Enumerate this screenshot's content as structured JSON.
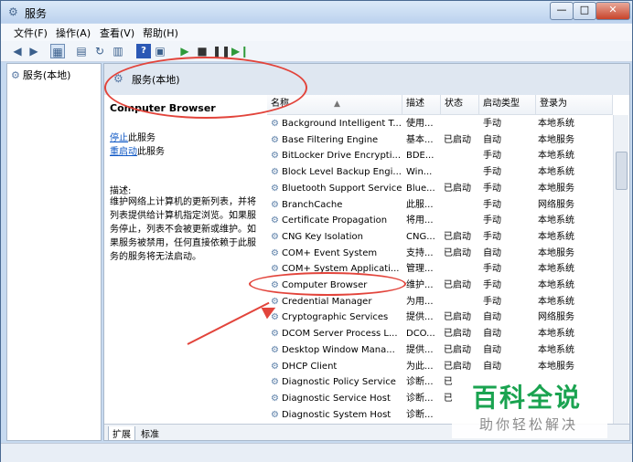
{
  "window": {
    "title": "服务",
    "min_glyph": "—",
    "max_glyph": "□",
    "close_glyph": "✕"
  },
  "menu": [
    "文件(F)",
    "操作(A)",
    "查看(V)",
    "帮助(H)"
  ],
  "toolbar": {
    "help_glyph": "?"
  },
  "tree": {
    "root_label": "服务(本地)"
  },
  "header": {
    "title": "服务(本地)"
  },
  "detail": {
    "service_name": "Computer Browser",
    "stop_link": "停止",
    "stop_suffix": "此服务",
    "restart_link": "重启动",
    "restart_suffix": "此服务",
    "desc_label": "描述:",
    "desc_text": "维护网络上计算机的更新列表，并将列表提供给计算机指定浏览。如果服务停止，列表不会被更新或维护。如果服务被禁用，任何直接依赖于此服务的服务将无法启动。"
  },
  "columns": {
    "name": "名称",
    "desc": "描述",
    "status": "状态",
    "startup": "启动类型",
    "logon": "登录为"
  },
  "services": [
    {
      "name": "Background Intelligent T...",
      "desc": "使用...",
      "status": "",
      "startup": "手动",
      "logon": "本地系统"
    },
    {
      "name": "Base Filtering Engine",
      "desc": "基本...",
      "status": "已启动",
      "startup": "自动",
      "logon": "本地服务"
    },
    {
      "name": "BitLocker Drive Encrypti...",
      "desc": "BDE...",
      "status": "",
      "startup": "手动",
      "logon": "本地系统"
    },
    {
      "name": "Block Level Backup Engi...",
      "desc": "Win...",
      "status": "",
      "startup": "手动",
      "logon": "本地系统"
    },
    {
      "name": "Bluetooth Support Service",
      "desc": "Blue...",
      "status": "已启动",
      "startup": "手动",
      "logon": "本地服务"
    },
    {
      "name": "BranchCache",
      "desc": "此服...",
      "status": "",
      "startup": "手动",
      "logon": "网络服务"
    },
    {
      "name": "Certificate Propagation",
      "desc": "将用...",
      "status": "",
      "startup": "手动",
      "logon": "本地系统"
    },
    {
      "name": "CNG Key Isolation",
      "desc": "CNG...",
      "status": "已启动",
      "startup": "手动",
      "logon": "本地系统"
    },
    {
      "name": "COM+ Event System",
      "desc": "支持...",
      "status": "已启动",
      "startup": "自动",
      "logon": "本地服务"
    },
    {
      "name": "COM+ System Applicati...",
      "desc": "管理...",
      "status": "",
      "startup": "手动",
      "logon": "本地系统"
    },
    {
      "name": "Computer Browser",
      "desc": "维护...",
      "status": "已启动",
      "startup": "手动",
      "logon": "本地系统"
    },
    {
      "name": "Credential Manager",
      "desc": "为用...",
      "status": "",
      "startup": "手动",
      "logon": "本地系统"
    },
    {
      "name": "Cryptographic Services",
      "desc": "提供...",
      "status": "已启动",
      "startup": "自动",
      "logon": "网络服务"
    },
    {
      "name": "DCOM Server Process L...",
      "desc": "DCO...",
      "status": "已启动",
      "startup": "自动",
      "logon": "本地系统"
    },
    {
      "name": "Desktop Window Mana...",
      "desc": "提供...",
      "status": "已启动",
      "startup": "自动",
      "logon": "本地系统"
    },
    {
      "name": "DHCP Client",
      "desc": "为此...",
      "status": "已启动",
      "startup": "自动",
      "logon": "本地服务"
    },
    {
      "name": "Diagnostic Policy Service",
      "desc": "诊断...",
      "status": "已",
      "startup": "",
      "logon": ""
    },
    {
      "name": "Diagnostic Service Host",
      "desc": "诊断...",
      "status": "已",
      "startup": "",
      "logon": ""
    },
    {
      "name": "Diagnostic System Host",
      "desc": "诊断...",
      "status": "",
      "startup": "",
      "logon": ""
    }
  ],
  "tabs": [
    "扩展",
    "标准"
  ],
  "watermark": {
    "big": "百科全说",
    "small": "助你轻松解决"
  }
}
